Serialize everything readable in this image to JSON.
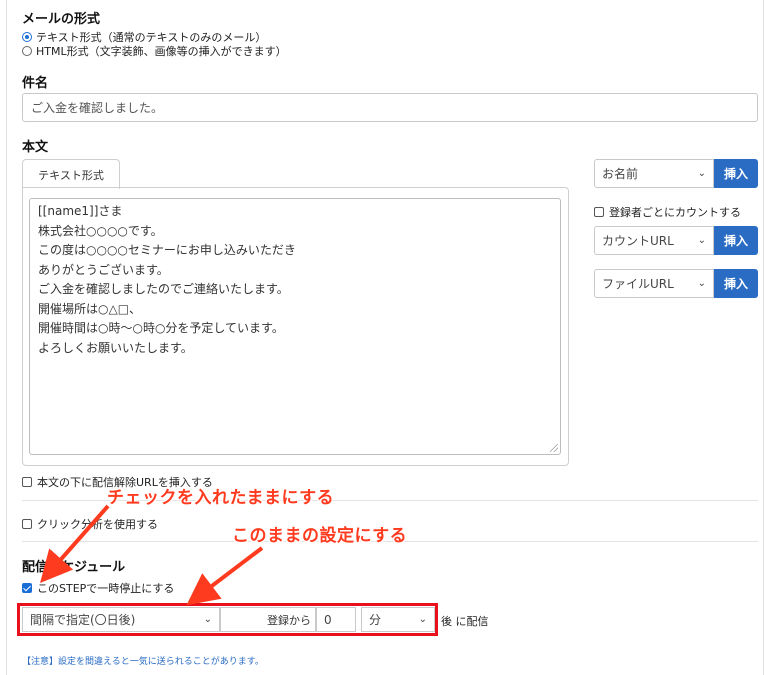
{
  "mail_format": {
    "heading": "メールの形式",
    "options": [
      {
        "label": "テキスト形式（通常のテキストのみのメール）",
        "selected": true
      },
      {
        "label": "HTML形式（文字装飾、画像等の挿入ができます）",
        "selected": false
      }
    ]
  },
  "subject": {
    "heading": "件名",
    "value": "ご入金を確認しました。"
  },
  "body": {
    "heading": "本文",
    "tab_label": "テキスト形式",
    "lines": [
      "[[name1]]さま",
      "",
      "株式会社○○○○です。",
      "",
      "この度は○○○○セミナーにお申し込みいただき",
      "ありがとうございます。",
      "",
      "ご入金を確認しましたのでご連絡いたします。",
      "",
      "開催場所は○△□、",
      "開催時間は○時～○時○分を予定しています。",
      "",
      "よろしくお願いいたします。"
    ]
  },
  "insert_panel": {
    "name_select": "お名前",
    "insert_label": "挿入",
    "count_checkbox_label": "登録者ごとにカウントする",
    "count_select": "カウントURL",
    "file_select": "ファイルURL"
  },
  "options": {
    "unsubscribe_label": "本文の下に配信解除URLを挿入する",
    "unsubscribe_checked": false,
    "click_analysis_label": "クリック分析を使用する",
    "click_analysis_checked": false
  },
  "schedule": {
    "heading": "配信スケジュール",
    "pause_label": "このSTEPで一時停止にする",
    "pause_checked": true,
    "interval_select": "間隔で指定(〇日後)",
    "from_label": "登録から",
    "amount_value": "0",
    "unit_select": "分",
    "after_label": "後 に配信",
    "note": "【注意】設定を間違えると一気に送られることがあります。"
  },
  "annotations": {
    "keep_checked": "チェックを入れたままにする",
    "keep_setting": "このままの設定にする",
    "color": "#ff3b1f"
  },
  "colors": {
    "accent": "#2a6cc4",
    "highlight_box": "#e8101a"
  }
}
